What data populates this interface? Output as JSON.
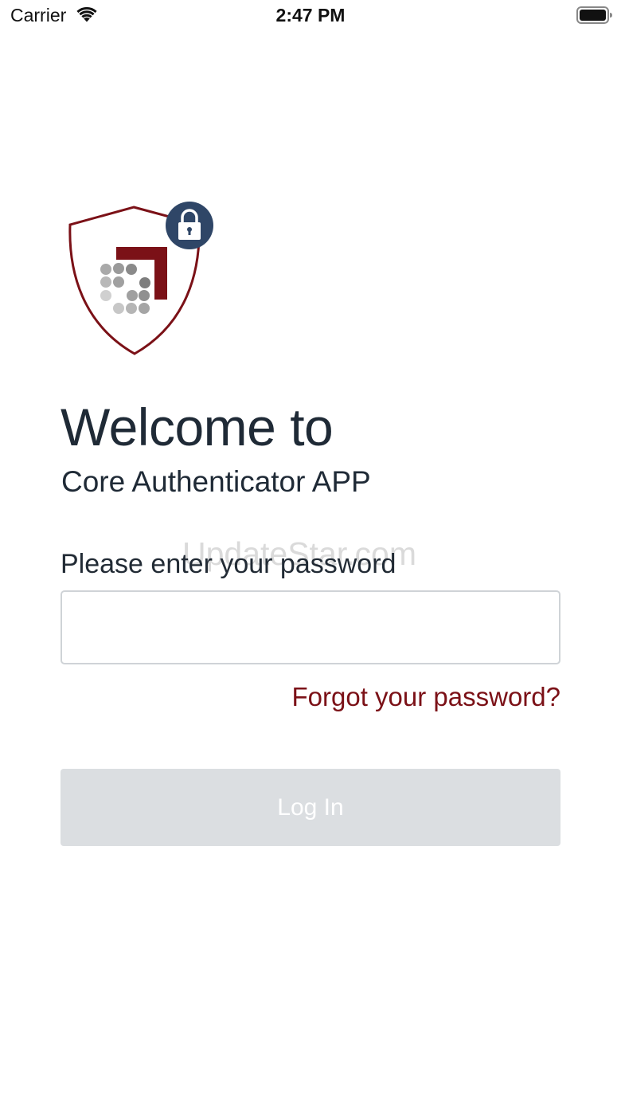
{
  "status_bar": {
    "carrier": "Carrier",
    "time": "2:47 PM",
    "wifi_icon": "wifi-icon",
    "battery_icon": "battery-icon"
  },
  "logo": {
    "icon": "shield-lock-logo",
    "shield_color": "#7b1117",
    "badge_color": "#2f4667"
  },
  "welcome": {
    "title": "Welcome to",
    "subtitle": "Core Authenticator APP"
  },
  "watermark": "UpdateStar.com",
  "password": {
    "label": "Please enter your password",
    "value": "",
    "placeholder": ""
  },
  "forgot_password_label": "Forgot your password?",
  "login_button_label": "Log In",
  "colors": {
    "accent": "#7b1117",
    "text": "#1f2a36",
    "button_disabled_bg": "#dbdee1"
  }
}
